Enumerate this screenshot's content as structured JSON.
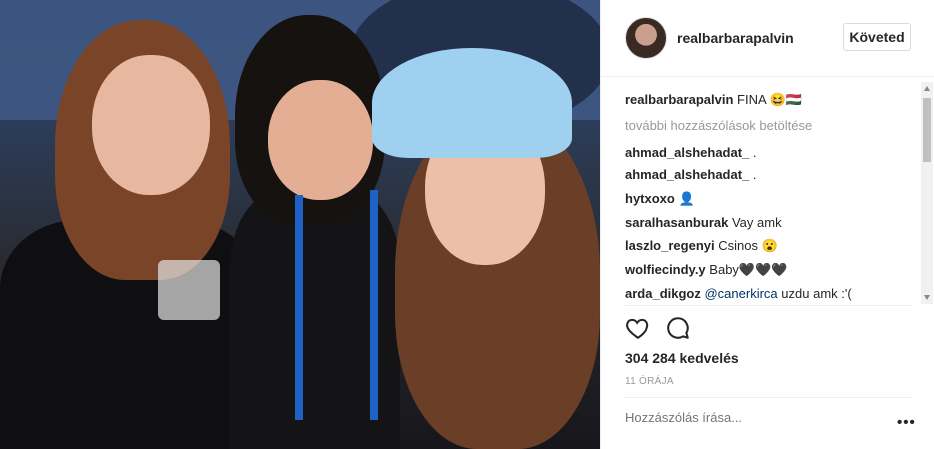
{
  "post": {
    "username": "realbarbarapalvin",
    "follow_label": "Követed",
    "caption_user": "realbarbarapalvin",
    "caption_text": "FINA 😆🇭🇺",
    "load_more": "további hozzászólások betöltése",
    "comments": [
      {
        "user": "ahmad_alshehadat_",
        "text": "."
      },
      {
        "user": "ahmad_alshehadat_",
        "text": "."
      },
      {
        "user": "hytxoxo",
        "text": "👤"
      },
      {
        "user": "saralhasanburak",
        "text": "Vay amk"
      },
      {
        "user": "laszlo_regenyi",
        "text": "Csinos 😮"
      },
      {
        "user": "wolfiecindy.y",
        "text": "Baby🖤🖤🖤"
      },
      {
        "user": "arda_dikgoz",
        "mention": "@canerkirca",
        "text": "uzdu amk :'("
      }
    ],
    "likes": "304 284 kedvelés",
    "time": "11 ÓRÁJA",
    "add_comment_placeholder": "Hozzászólás írása...",
    "more_label": "•••"
  },
  "colors": {
    "text": "#262626",
    "muted": "#999999",
    "mention": "#003569",
    "border": "#efefef"
  }
}
